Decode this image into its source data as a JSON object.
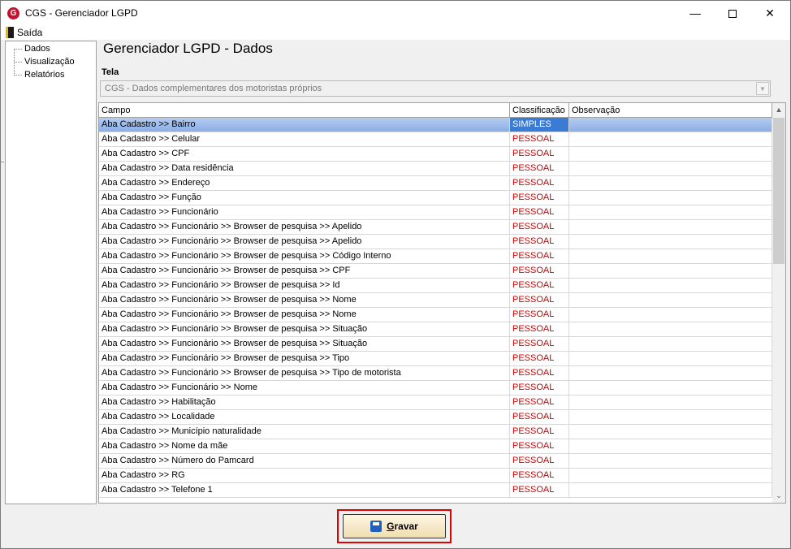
{
  "window": {
    "title": "CGS - Gerenciador LGPD",
    "app_icon_letter": "G",
    "minimize_glyph": "—",
    "close_glyph": "✕"
  },
  "menu": {
    "exit_label": "Saída"
  },
  "sidebar": {
    "items": [
      {
        "label": "Dados"
      },
      {
        "label": "Visualização"
      },
      {
        "label": "Relatórios"
      }
    ]
  },
  "main": {
    "title": "Gerenciador LGPD - Dados",
    "tela_label": "Tela",
    "tela_value": "CGS - Dados complementares dos motoristas próprios",
    "combo_arrow": "▼"
  },
  "grid": {
    "columns": [
      "Campo",
      "Classificação",
      "Observação"
    ],
    "rows": [
      {
        "campo": "Aba Cadastro >> Bairro",
        "classificacao": "SIMPLES",
        "observacao": ""
      },
      {
        "campo": "Aba Cadastro >> Celular",
        "classificacao": "PESSOAL",
        "observacao": ""
      },
      {
        "campo": "Aba Cadastro >> CPF",
        "classificacao": "PESSOAL",
        "observacao": ""
      },
      {
        "campo": "Aba Cadastro >> Data residência",
        "classificacao": "PESSOAL",
        "observacao": ""
      },
      {
        "campo": "Aba Cadastro >> Endereço",
        "classificacao": "PESSOAL",
        "observacao": ""
      },
      {
        "campo": "Aba Cadastro >> Função",
        "classificacao": "PESSOAL",
        "observacao": ""
      },
      {
        "campo": "Aba Cadastro >> Funcionário",
        "classificacao": "PESSOAL",
        "observacao": ""
      },
      {
        "campo": "Aba Cadastro >> Funcionário >> Browser de pesquisa >> Apelido",
        "classificacao": "PESSOAL",
        "observacao": ""
      },
      {
        "campo": "Aba Cadastro >> Funcionário >> Browser de pesquisa >> Apelido",
        "classificacao": "PESSOAL",
        "observacao": ""
      },
      {
        "campo": "Aba Cadastro >> Funcionário >> Browser de pesquisa >> Código Interno",
        "classificacao": "PESSOAL",
        "observacao": ""
      },
      {
        "campo": "Aba Cadastro >> Funcionário >> Browser de pesquisa >> CPF",
        "classificacao": "PESSOAL",
        "observacao": ""
      },
      {
        "campo": "Aba Cadastro >> Funcionário >> Browser de pesquisa >> Id",
        "classificacao": "PESSOAL",
        "observacao": ""
      },
      {
        "campo": "Aba Cadastro >> Funcionário >> Browser de pesquisa >> Nome",
        "classificacao": "PESSOAL",
        "observacao": ""
      },
      {
        "campo": "Aba Cadastro >> Funcionário >> Browser de pesquisa >> Nome",
        "classificacao": "PESSOAL",
        "observacao": ""
      },
      {
        "campo": "Aba Cadastro >> Funcionário >> Browser de pesquisa >> Situação",
        "classificacao": "PESSOAL",
        "observacao": ""
      },
      {
        "campo": "Aba Cadastro >> Funcionário >> Browser de pesquisa >> Situação",
        "classificacao": "PESSOAL",
        "observacao": ""
      },
      {
        "campo": "Aba Cadastro >> Funcionário >> Browser de pesquisa >> Tipo",
        "classificacao": "PESSOAL",
        "observacao": ""
      },
      {
        "campo": "Aba Cadastro >> Funcionário >> Browser de pesquisa >> Tipo de motorista",
        "classificacao": "PESSOAL",
        "observacao": ""
      },
      {
        "campo": "Aba Cadastro >> Funcionário >> Nome",
        "classificacao": "PESSOAL",
        "observacao": ""
      },
      {
        "campo": "Aba Cadastro >> Habilitação",
        "classificacao": "PESSOAL",
        "observacao": ""
      },
      {
        "campo": "Aba Cadastro >> Localidade",
        "classificacao": "PESSOAL",
        "observacao": ""
      },
      {
        "campo": "Aba Cadastro >> Município naturalidade",
        "classificacao": "PESSOAL",
        "observacao": ""
      },
      {
        "campo": "Aba Cadastro >> Nome da mãe",
        "classificacao": "PESSOAL",
        "observacao": ""
      },
      {
        "campo": "Aba Cadastro >> Número do Pamcard",
        "classificacao": "PESSOAL",
        "observacao": ""
      },
      {
        "campo": "Aba Cadastro >> RG",
        "classificacao": "PESSOAL",
        "observacao": ""
      },
      {
        "campo": "Aba Cadastro >> Telefone 1",
        "classificacao": "PESSOAL",
        "observacao": ""
      }
    ],
    "selected_row": 0,
    "scroll_up_glyph": "▲",
    "scroll_down_glyph": "⌄"
  },
  "footer": {
    "save_label_mnemonic": "G",
    "save_label_rest": "ravar"
  },
  "colors": {
    "pessoal": "#d00000",
    "selection": "#3a7bd5",
    "highlight_border": "#e00000"
  }
}
